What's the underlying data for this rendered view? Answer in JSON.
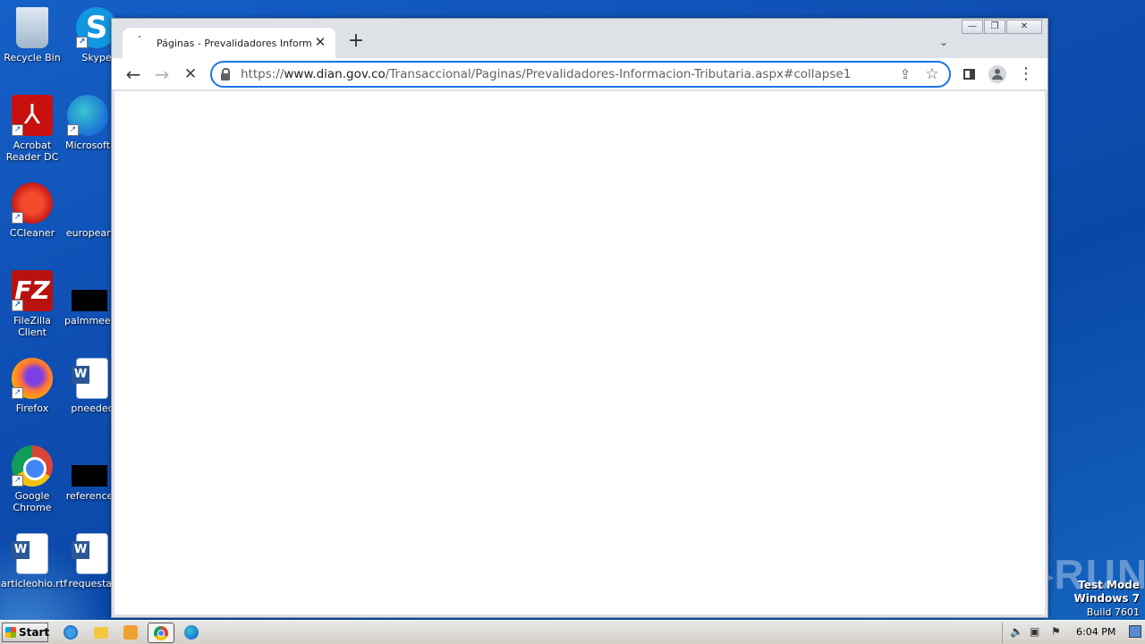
{
  "desktop": {
    "icons": [
      {
        "label": "Recycle Bin"
      },
      {
        "label": "Skype"
      },
      {
        "label": "Acrobat Reader DC"
      },
      {
        "label": "Microsoft"
      },
      {
        "label": "CCleaner"
      },
      {
        "label": "european"
      },
      {
        "label": "FileZilla Client"
      },
      {
        "label": "palmmeet"
      },
      {
        "label": "Firefox"
      },
      {
        "label": "pneedec"
      },
      {
        "label": "Google Chrome"
      },
      {
        "label": "reference"
      },
      {
        "label": "articleohio.rtf"
      },
      {
        "label": "requestat"
      }
    ]
  },
  "browser": {
    "tab": {
      "title": "Páginas - Prevalidadores Informacion",
      "close_glyph": "✕"
    },
    "new_tab_glyph": "+",
    "tab_search_glyph": "⌄",
    "window_controls": {
      "minimize": "—",
      "maximize": "❐",
      "close": "✕"
    },
    "nav": {
      "back": "←",
      "forward": "→",
      "stop": "✕"
    },
    "address": {
      "scheme": "https://",
      "host": "www.dian.gov.co",
      "path": "/Transaccional/Paginas/Prevalidadores-Informacion-Tributaria.aspx#collapse1"
    },
    "share_glyph": "⇪",
    "star_glyph": "☆",
    "menu_glyph": "⋮"
  },
  "watermark": "ANY▷RUN",
  "test_mode": {
    "line1": "Test Mode",
    "line2": "Windows 7",
    "line3": "Build 7601"
  },
  "taskbar": {
    "start_label": "Start",
    "clock": "6:04 PM"
  },
  "colors": {
    "desktop": "#1257c0",
    "accent": "#1a73e8",
    "tab_bg": "#dee1e6"
  }
}
